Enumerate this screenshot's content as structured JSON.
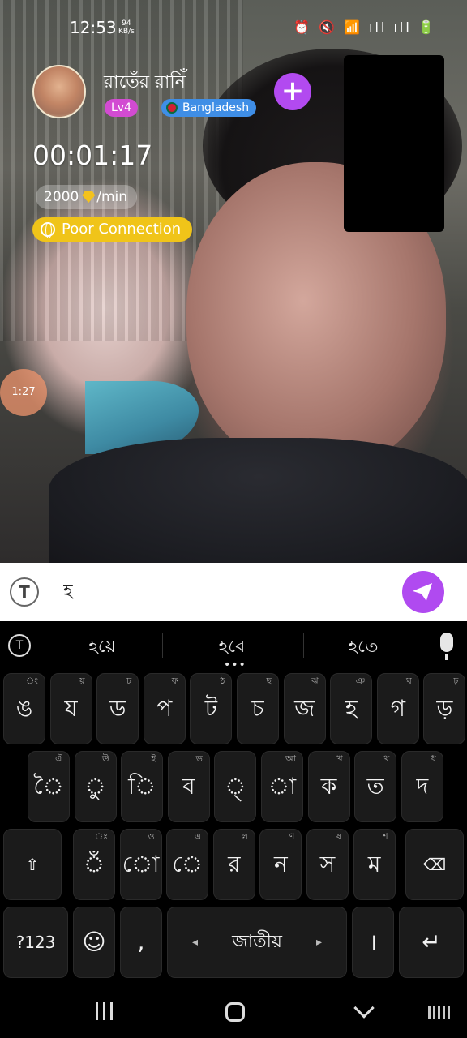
{
  "status_bar": {
    "time": "12:53",
    "speed_value": "94",
    "speed_unit": "KB/s",
    "right_icons": "⏰ 🔇 📶 ıll ıll 🔋"
  },
  "host": {
    "name": "রাতেঁর রানিঁ",
    "level": "Lv4",
    "country": "Bangladesh"
  },
  "call": {
    "timer": "00:01:17",
    "rate_amount": "2000",
    "rate_unit": "/min",
    "connection_status": "Poor Connection",
    "floating_timer": "1:27"
  },
  "message": {
    "value": "হ"
  },
  "keyboard": {
    "suggestions": [
      "হয়ে",
      "হবে",
      "হতে"
    ],
    "row1": [
      {
        "key": "ঙ",
        "hint": "ং"
      },
      {
        "key": "য",
        "hint": "য়"
      },
      {
        "key": "ড",
        "hint": "ঢ"
      },
      {
        "key": "প",
        "hint": "ফ"
      },
      {
        "key": "ট",
        "hint": "ঠ"
      },
      {
        "key": "চ",
        "hint": "ছ"
      },
      {
        "key": "জ",
        "hint": "ঝ"
      },
      {
        "key": "হ",
        "hint": "ঞ"
      },
      {
        "key": "গ",
        "hint": "ঘ"
      },
      {
        "key": "ড়",
        "hint": "ঢ়"
      }
    ],
    "row2": [
      {
        "key": "ৈ",
        "hint": "ঐ"
      },
      {
        "key": "ু",
        "hint": "উ"
      },
      {
        "key": "ি",
        "hint": "ই"
      },
      {
        "key": "ব",
        "hint": "ভ"
      },
      {
        "key": "্",
        "hint": ""
      },
      {
        "key": "া",
        "hint": "আ"
      },
      {
        "key": "ক",
        "hint": "খ"
      },
      {
        "key": "ত",
        "hint": "থ"
      },
      {
        "key": "দ",
        "hint": "ধ"
      }
    ],
    "row3": [
      {
        "key": "ঁ",
        "hint": "ঃ"
      },
      {
        "key": "ো",
        "hint": "ও"
      },
      {
        "key": "ে",
        "hint": "এ"
      },
      {
        "key": "র",
        "hint": "ল"
      },
      {
        "key": "ন",
        "hint": "ণ"
      },
      {
        "key": "স",
        "hint": "ষ"
      },
      {
        "key": "ম",
        "hint": "শ"
      }
    ],
    "shift_label": "⇧",
    "backspace_label": "⌫",
    "symbols_label": "?123",
    "emoji_label": "☺",
    "comma_label": ",",
    "space_label": "জাতীয়",
    "space_left": "◂",
    "space_right": "▸",
    "period_label": "।",
    "enter_label": "↵"
  }
}
